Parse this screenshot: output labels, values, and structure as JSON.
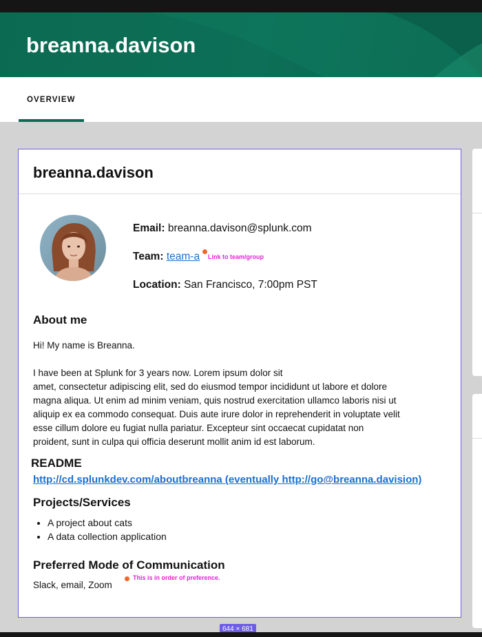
{
  "banner": {
    "title": "breanna.davison"
  },
  "tabs": [
    {
      "label": "OVERVIEW",
      "active": true
    }
  ],
  "profile": {
    "username": "breanna.davison",
    "email_label": "Email:",
    "email": "breanna.davison@splunk.com",
    "team_label": "Team:",
    "team": "team-a",
    "team_note": "Link to team/group",
    "location_label": "Location:",
    "location": "San Francisco, 7:00pm PST"
  },
  "about": {
    "title": "About me",
    "intro": "Hi! My name is Breanna.",
    "paragraph_lines": [
      "I have been at Splunk for 3 years now. Lorem ipsum dolor sit",
      "amet, consectetur adipiscing elit, sed do eiusmod tempor incididunt ut labore et dolore",
      "magna aliqua. Ut enim ad minim veniam, quis nostrud exercitation ullamco laboris nisi ut",
      "aliquip ex ea commodo consequat. Duis aute irure dolor in reprehenderit in voluptate velit",
      "esse cillum dolore eu fugiat nulla pariatur. Excepteur sint occaecat cupidatat non",
      "proident, sunt in culpa qui officia deserunt mollit anim id est laborum."
    ]
  },
  "readme": {
    "title": "README",
    "link": "http://cd.splunkdev.com/aboutbreanna (eventually http://go@breanna.davision)"
  },
  "projects": {
    "title": "Projects/Services",
    "items": [
      "A project about cats",
      "A data collection application"
    ]
  },
  "communication": {
    "title": "Preferred Mode of Communication",
    "value": "Slack, email, Zoom",
    "note": "This is in order of preference."
  },
  "size_badge": "644 × 681",
  "colors": {
    "accent": "#0b6b52",
    "link": "#1a6fd1",
    "selection": "#6c5ce7",
    "annotation_dot": "#f0672a",
    "annotation_text": "#e41fd6"
  }
}
